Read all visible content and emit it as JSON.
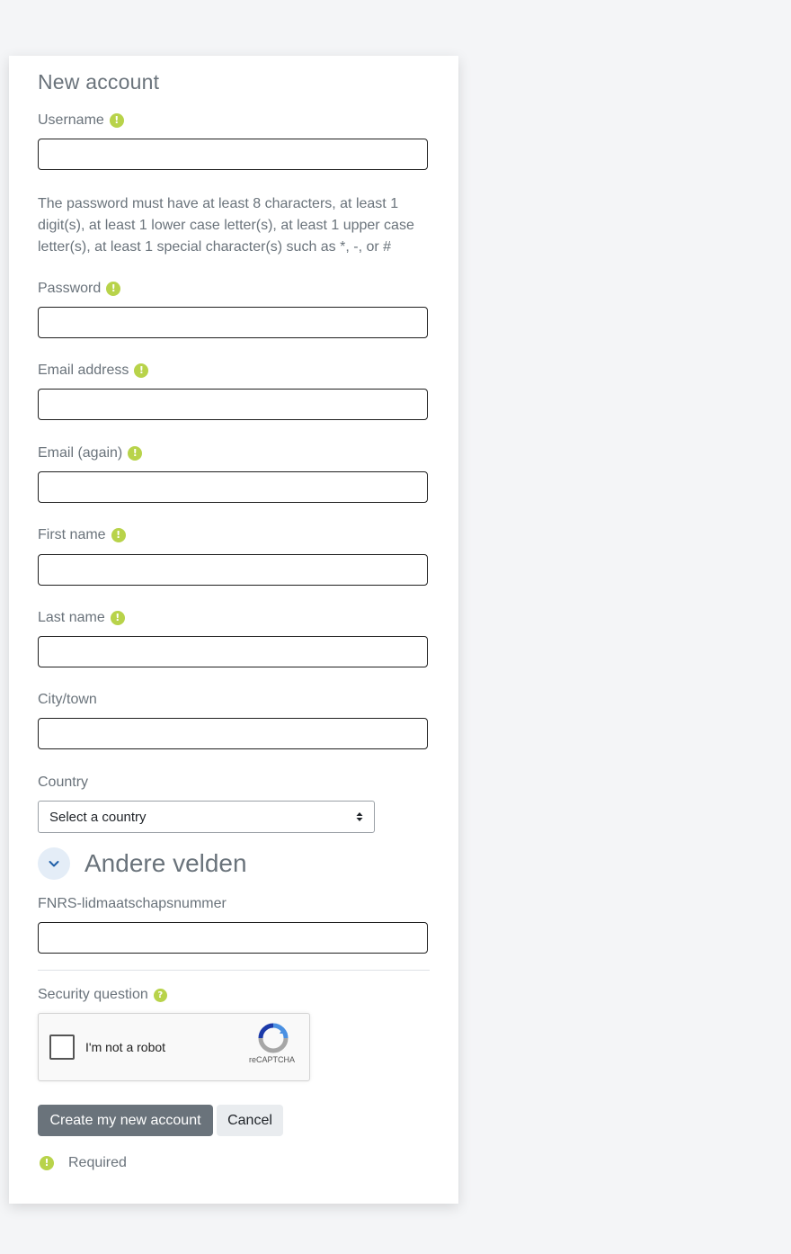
{
  "form": {
    "title": "New account",
    "password_policy": "The password must have at least 8 characters, at least 1 digit(s), at least 1 lower case letter(s), at least 1 upper case letter(s), at least 1 special character(s) such as *, -, or #",
    "fields": {
      "username": {
        "label": "Username",
        "value": ""
      },
      "password": {
        "label": "Password",
        "value": ""
      },
      "email": {
        "label": "Email address",
        "value": ""
      },
      "email_again": {
        "label": "Email (again)",
        "value": ""
      },
      "first_name": {
        "label": "First name",
        "value": ""
      },
      "last_name": {
        "label": "Last name",
        "value": ""
      },
      "city": {
        "label": "City/town",
        "value": ""
      },
      "country": {
        "label": "Country",
        "selected": "Select a country"
      },
      "fnrs": {
        "label": "FNRS-lidmaatschapsnummer",
        "value": ""
      }
    },
    "section_other": "Andere velden",
    "security": {
      "label": "Security question",
      "captcha_text": "I'm not a robot",
      "captcha_brand": "reCAPTCHA"
    },
    "buttons": {
      "create": "Create my new account",
      "cancel": "Cancel"
    },
    "legend_required": "Required",
    "required_icon": "!",
    "help_icon": "?"
  },
  "colors": {
    "required_badge": "#b8d34a",
    "primary_button": "#6a737b",
    "secondary_button": "#e9ecef",
    "text": "#6a737b"
  }
}
